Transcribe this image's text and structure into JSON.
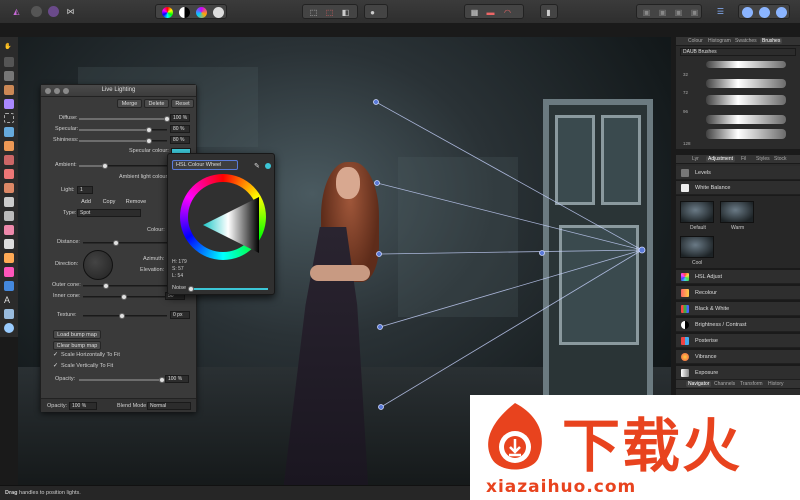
{
  "panel": {
    "title": "Live Lighting",
    "buttons": {
      "merge": "Merge",
      "delete": "Delete",
      "reset": "Reset"
    },
    "diffuse": {
      "label": "Diffuse:",
      "value": "100 %",
      "fraction": 1.0
    },
    "specular": {
      "label": "Specular:",
      "value": "80 %",
      "fraction": 0.8
    },
    "shininess": {
      "label": "Shininess:",
      "value": "80 %",
      "fraction": 0.8
    },
    "specular_colour_label": "Specular colour:",
    "ambient": {
      "label": "Ambient:",
      "fraction": 0.3
    },
    "ambient_colour_label": "Ambient light colour:",
    "light_label": "Light:",
    "light_value": "1",
    "add": "Add",
    "copy": "Copy",
    "remove": "Remove",
    "type_label": "Type:",
    "type_value": "Spot",
    "colour_label": "Colour:",
    "distance_label": "Distance:",
    "direction_label": "Direction:",
    "azimuth_label": "Azimuth:",
    "elevation_label": "Elevation:",
    "outer_cone_label": "Outer cone:",
    "inner_cone_label": "Inner cone:",
    "inner_cone_value": "50 °",
    "texture_label": "Texture:",
    "texture_value": "0 px",
    "load_bump": "Load bump map",
    "clear_bump": "Clear bump map",
    "scale_h": "Scale Horizontally To Fit",
    "scale_v": "Scale Vertically To Fit",
    "opacity_label": "Opacity:",
    "opacity_value": "100 %",
    "footer_opacity_label": "Opacity:",
    "footer_opacity_value": "100 %",
    "blend_label": "Blend Mode:",
    "blend_value": "Normal"
  },
  "colour_popup": {
    "mode": "HSL Colour Wheel",
    "h": "H: 179",
    "s": "S: 57",
    "l": "L: 54",
    "noise_label": "Noise"
  },
  "right_panel": {
    "top_tabs": [
      "Colour",
      "Histogram",
      "Swatches",
      "Brushes"
    ],
    "brush_category": "DAUB Brushes",
    "brush_sizes": [
      "32",
      "72",
      "96",
      "",
      "128"
    ],
    "mid_tabs": [
      "Lyr",
      "Adjustment",
      "Fil",
      "Styles",
      "Stock"
    ],
    "adjustments_top": [
      "Levels",
      "White Balance"
    ],
    "presets": [
      "Default",
      "Warm",
      "Cool"
    ],
    "adjustments": [
      "HSL Adjust",
      "Recolour",
      "Black & White",
      "Brightness / Contrast",
      "Posterise",
      "Vibrance",
      "Exposure"
    ],
    "bottom_tabs": [
      "Navigator",
      "Channels",
      "Transform",
      "History"
    ]
  },
  "status": {
    "text_bold": "Drag",
    "text": " handles to position lights."
  },
  "watermark": {
    "chars": "下载火",
    "url": "xiazaihuo.com"
  },
  "colors": {
    "accent": "#3cc6d6",
    "watermark": "#e8431e"
  }
}
